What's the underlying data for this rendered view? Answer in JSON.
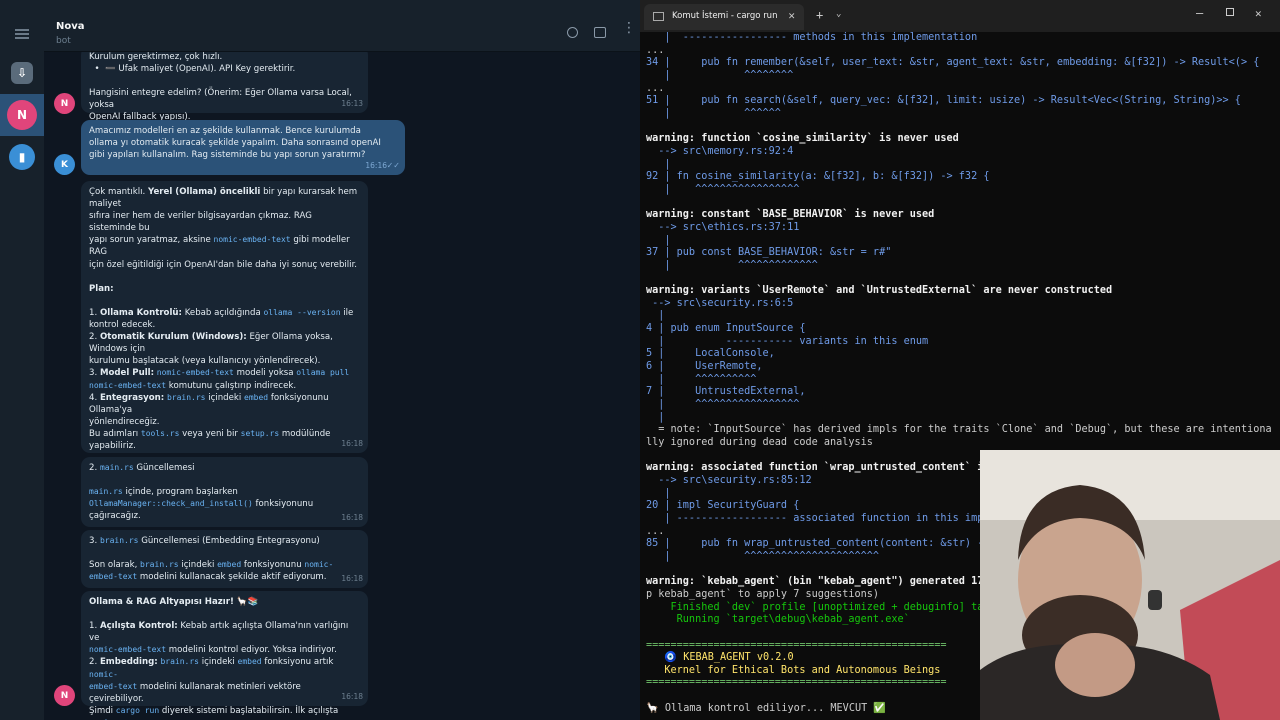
{
  "telegram": {
    "chat_name": "Nova",
    "chat_status": "bot",
    "messages": [
      {
        "lines": [
          "Kurulum gerektirmez, çok hızlı.",
          "  •  ➖ Ufak maliyet (OpenAI). API Key gerektirir.",
          "",
          "Hangisini entegre edelim? (Önerim: Eğer Ollama varsa Local, yoksa",
          "OpenAI fallback yapısı)."
        ],
        "time": "16:13"
      },
      {
        "lines": [
          "Amacımız modelleri en az şekilde kullanmak. Bence kurulumda",
          "ollama yı otomatik kuracak şekilde yapalım. Daha sonrasınd openAI",
          "gibi yapıları kullanalım. Rag sisteminde bu yapı sorun yaratırmı?"
        ],
        "time": "16:16"
      },
      {
        "time": "16:18"
      },
      {
        "time": "16:18"
      },
      {
        "time": "16:18"
      },
      {
        "time": "16:18"
      }
    ],
    "avatars": {
      "n": "N",
      "k": "K"
    }
  },
  "terminal": {
    "tab_title": "Komut İstemi - cargo  run",
    "lines": [
      [
        "   |  ----------------- methods in this implementation"
      ],
      [
        "..."
      ],
      [
        "34 |     pub fn remember(&self, user_text: &str, agent_text: &str, embedding: &[f32]) -> Result<(> {"
      ],
      [
        "   |            ^^^^^^^^"
      ],
      [
        "..."
      ],
      [
        "51 |     pub fn search(&self, query_vec: &[f32], limit: usize) -> Result<Vec<(String, String)>> {"
      ],
      [
        "   |            ^^^^^^"
      ],
      [
        ""
      ],
      [
        "warning: function `cosine_similarity` is never used"
      ],
      [
        "  --> src\\memory.rs:92:4"
      ],
      [
        "   |"
      ],
      [
        "92 | fn cosine_similarity(a: &[f32], b: &[f32]) -> f32 {"
      ],
      [
        "   |    ^^^^^^^^^^^^^^^^^"
      ],
      [
        ""
      ],
      [
        "warning: constant `BASE_BEHAVIOR` is never used"
      ],
      [
        "  --> src\\ethics.rs:37:11"
      ],
      [
        "   |"
      ],
      [
        "37 | pub const BASE_BEHAVIOR: &str = r#\""
      ],
      [
        "   |           ^^^^^^^^^^^^^"
      ],
      [
        ""
      ],
      [
        "warning: variants `UserRemote` and `UntrustedExternal` are never constructed"
      ],
      [
        " --> src\\security.rs:6:5"
      ],
      [
        "  |"
      ],
      [
        "4 | pub enum InputSource {"
      ],
      [
        "  |          ----------- variants in this enum"
      ],
      [
        "5 |     LocalConsole,"
      ],
      [
        "6 |     UserRemote,"
      ],
      [
        "  |     ^^^^^^^^^^"
      ],
      [
        "7 |     UntrustedExternal,"
      ],
      [
        "  |     ^^^^^^^^^^^^^^^^^"
      ],
      [
        "  |"
      ],
      [
        "  = note: `InputSource` has derived impls for the traits `Clone` and `Debug`, but these are intentiona"
      ],
      [
        "lly ignored during dead code analysis"
      ],
      [
        ""
      ],
      [
        "warning: associated function `wrap_untrusted_content` is"
      ],
      [
        "  --> src\\security.rs:85:12"
      ],
      [
        "   |"
      ],
      [
        "20 | impl SecurityGuard {"
      ],
      [
        "   | ------------------ associated function in this impl"
      ],
      [
        "..."
      ],
      [
        "85 |     pub fn wrap_untrusted_content(content: &str) ->"
      ],
      [
        "   |            ^^^^^^^^^^^^^^^^^^^^^^"
      ],
      [
        ""
      ],
      [
        "warning: `kebab_agent` (bin \"kebab_agent\") generated 17"
      ],
      [
        "p kebab_agent` to apply 7 suggestions)"
      ],
      [
        "    Finished `dev` profile [unoptimized + debuginfo] tar"
      ],
      [
        "     Running `target\\debug\\kebab_agent.exe`"
      ],
      [
        ""
      ],
      [
        "================================================="
      ],
      [
        "   🧿 KEBAB_AGENT v0.2.0"
      ],
      [
        "   Kernel for Ethical Bots and Autonomous Beings"
      ],
      [
        "================================================="
      ],
      [
        ""
      ],
      [
        "🦙 Ollama kontrol ediliyor... MEVCUT ✅"
      ]
    ]
  }
}
